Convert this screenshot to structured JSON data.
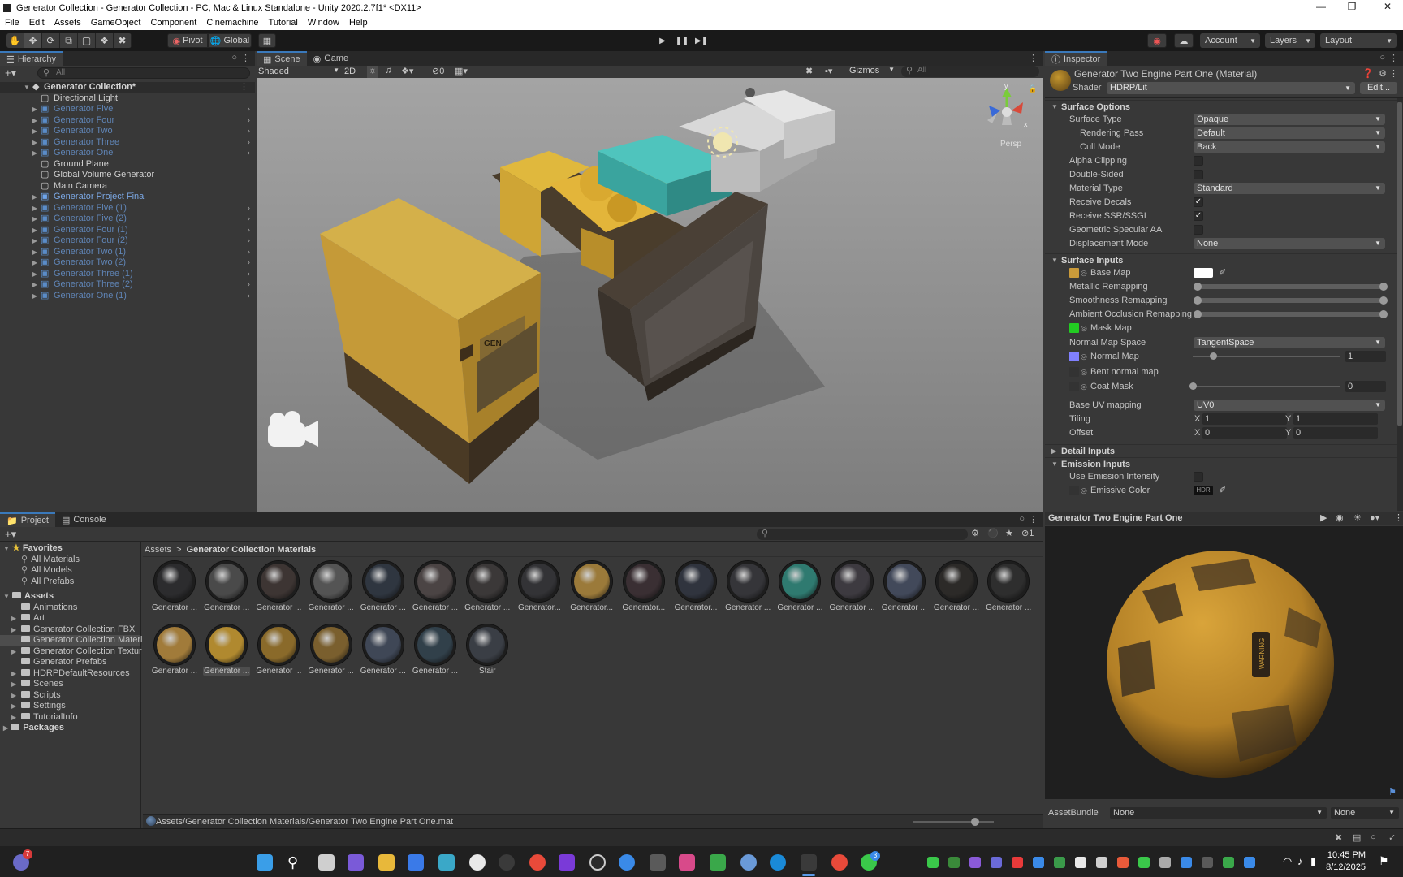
{
  "window": {
    "title": "Generator Collection - Generator Collection - PC, Mac & Linux Standalone - Unity 2020.2.7f1* <DX11>"
  },
  "menu": [
    "File",
    "Edit",
    "Assets",
    "GameObject",
    "Component",
    "Cinemachine",
    "Tutorial",
    "Window",
    "Help"
  ],
  "toolbar": {
    "pivot": "Pivot",
    "global": "Global",
    "account": "Account",
    "layers": "Layers",
    "layout": "Layout"
  },
  "hierarchy": {
    "tab": "Hierarchy",
    "search_placeholder": "All",
    "root": "Generator Collection*",
    "items": [
      {
        "label": "Directional Light",
        "type": "go",
        "expand": false,
        "chev": false
      },
      {
        "label": "Generator Five",
        "type": "prefab-dim",
        "expand": true,
        "chev": true
      },
      {
        "label": "Generator Four",
        "type": "prefab-dim",
        "expand": true,
        "chev": true
      },
      {
        "label": "Generator Two",
        "type": "prefab-dim",
        "expand": true,
        "chev": true
      },
      {
        "label": "Generator Three",
        "type": "prefab-dim",
        "expand": true,
        "chev": true
      },
      {
        "label": "Generator One",
        "type": "prefab-dim",
        "expand": true,
        "chev": true
      },
      {
        "label": "Ground Plane",
        "type": "go",
        "expand": false,
        "chev": false
      },
      {
        "label": "Global Volume Generator",
        "type": "go",
        "expand": false,
        "chev": false
      },
      {
        "label": "Main Camera",
        "type": "go",
        "expand": false,
        "chev": false
      },
      {
        "label": "Generator Project Final",
        "type": "prefab",
        "expand": true,
        "chev": false
      },
      {
        "label": "Generator Five (1)",
        "type": "prefab-dim",
        "expand": true,
        "chev": true
      },
      {
        "label": "Generator Five (2)",
        "type": "prefab-dim",
        "expand": true,
        "chev": true
      },
      {
        "label": "Generator Four (1)",
        "type": "prefab-dim",
        "expand": true,
        "chev": true
      },
      {
        "label": "Generator Four (2)",
        "type": "prefab-dim",
        "expand": true,
        "chev": true
      },
      {
        "label": "Generator Two (1)",
        "type": "prefab-dim",
        "expand": true,
        "chev": true
      },
      {
        "label": "Generator Two (2)",
        "type": "prefab-dim",
        "expand": true,
        "chev": true
      },
      {
        "label": "Generator Three (1)",
        "type": "prefab-dim",
        "expand": true,
        "chev": true
      },
      {
        "label": "Generator Three (2)",
        "type": "prefab-dim",
        "expand": true,
        "chev": true
      },
      {
        "label": "Generator One (1)",
        "type": "prefab-dim",
        "expand": true,
        "chev": true
      }
    ]
  },
  "scene": {
    "tabs": [
      "Scene",
      "Game"
    ],
    "shading": "Shaded",
    "mode2d": "2D",
    "hidden_count": "0",
    "gizmos": "Gizmos",
    "search_placeholder": "All",
    "persp": "Persp",
    "axis_y": "y",
    "axis_x": "x",
    "sign_text": "GEN"
  },
  "inspector": {
    "tab": "Inspector",
    "material_name": "Generator Two Engine Part One (Material)",
    "shader_label": "Shader",
    "shader_value": "HDRP/Lit",
    "edit_button": "Edit...",
    "surface_options": "Surface Options",
    "surface_type": {
      "label": "Surface Type",
      "value": "Opaque"
    },
    "rendering_pass": {
      "label": "Rendering Pass",
      "value": "Default"
    },
    "cull_mode": {
      "label": "Cull Mode",
      "value": "Back"
    },
    "alpha_clipping": {
      "label": "Alpha Clipping",
      "checked": false
    },
    "double_sided": {
      "label": "Double-Sided",
      "checked": false
    },
    "material_type": {
      "label": "Material Type",
      "value": "Standard"
    },
    "receive_decals": {
      "label": "Receive Decals",
      "checked": true
    },
    "receive_ssr": {
      "label": "Receive SSR/SSGI",
      "checked": true
    },
    "geometric_specular": {
      "label": "Geometric Specular AA",
      "checked": false
    },
    "displacement_mode": {
      "label": "Displacement Mode",
      "value": "None"
    },
    "surface_inputs": "Surface Inputs",
    "base_map": "Base Map",
    "metallic_remapping": "Metallic Remapping",
    "smoothness_remapping": "Smoothness Remapping",
    "ao_remapping": "Ambient Occlusion Remapping",
    "mask_map": "Mask Map",
    "normal_map_space": {
      "label": "Normal Map Space",
      "value": "TangentSpace"
    },
    "normal_map": {
      "label": "Normal Map",
      "value": "1",
      "fraction": 0.14
    },
    "bent_normal_map": "Bent normal map",
    "coat_mask": {
      "label": "Coat Mask",
      "value": "0",
      "fraction": 0
    },
    "base_uv_mapping": {
      "label": "Base UV mapping",
      "value": "UV0"
    },
    "tiling": {
      "label": "Tiling",
      "x_label": "X",
      "x": "1",
      "y_label": "Y",
      "y": "1"
    },
    "offset": {
      "label": "Offset",
      "x_label": "X",
      "x": "0",
      "y_label": "Y",
      "y": "0"
    },
    "detail_inputs": "Detail Inputs",
    "emission_inputs": "Emission Inputs",
    "use_emission_intensity": {
      "label": "Use Emission Intensity",
      "checked": false
    },
    "emissive_color": {
      "label": "Emissive Color",
      "badge": "HDR"
    },
    "preview_title": "Generator Two Engine Part One",
    "sphere_text": "WARNING",
    "assetbundle_label": "AssetBundle",
    "assetbundle_value": "None",
    "assetbundle_variant": "None"
  },
  "project": {
    "tabs": [
      "Project",
      "Console"
    ],
    "favorites": "Favorites",
    "fav_items": [
      "All Materials",
      "All Models",
      "All Prefabs"
    ],
    "assets": "Assets",
    "folders": [
      "Animations",
      "Art",
      "Generator Collection FBX",
      "Generator Collection Materi",
      "Generator Collection Textur",
      "Generator Prefabs",
      "HDRPDefaultResources",
      "Scenes",
      "Scripts",
      "Settings",
      "TutorialInfo"
    ],
    "selected_folder_index": 3,
    "packages": "Packages",
    "breadcrumb_root": "Assets",
    "breadcrumb_sep": ">",
    "breadcrumb_current": "Generator Collection Materials",
    "hidden_count": "1",
    "assets_row1": [
      "Generator ...",
      "Generator ...",
      "Generator ...",
      "Generator ...",
      "Generator ...",
      "Generator ...",
      "Generator ...",
      "Generator...",
      "Generator...",
      "Generator...",
      "Generator...",
      "Generator ...",
      "Generator ...",
      "Generator ...",
      "Generator ...",
      "Generator ...",
      "Generator ..."
    ],
    "colors_row1": [
      "#2c2c2e",
      "#4a4a4a",
      "#3d3533",
      "#545454",
      "#2f3640",
      "#4b4444",
      "#3b3838",
      "#333336",
      "#9b7a3a",
      "#3a2f33",
      "#30343e",
      "#353539",
      "#2f7a70",
      "#3d3a40",
      "#42495a",
      "#2c2a28",
      "#2e2e2e"
    ],
    "assets_row2": [
      "Generator ...",
      "Generator ...",
      "Generator ...",
      "Generator ...",
      "Generator ...",
      "Generator ...",
      "Stair"
    ],
    "colors_row2": [
      "#a17b3a",
      "#b0892f",
      "#8a6a2a",
      "#7a5f2e",
      "#3f4756",
      "#31404a",
      "#3a3e45"
    ],
    "selected_asset_row2": 1,
    "status_path": "Assets/Generator Collection Materials/Generator Two Engine Part One.mat"
  },
  "taskbar": {
    "time": "10:45 PM",
    "date": "8/12/2025",
    "notif_count": "7",
    "whatsapp_count": "3"
  },
  "colors": {
    "accent": "#3a79bb",
    "prefab": "#7ba7e3",
    "prefab_dim": "#5f84b5",
    "editor_bg": "#383838"
  }
}
